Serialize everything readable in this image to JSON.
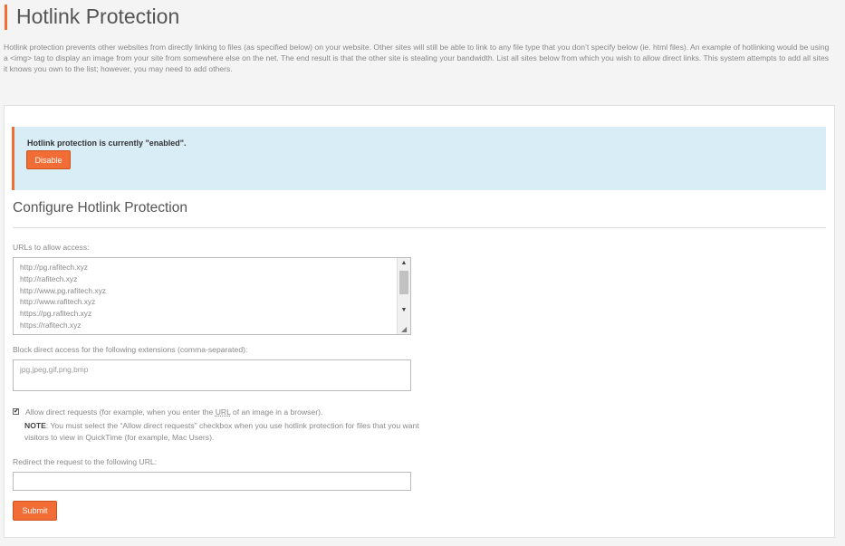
{
  "page": {
    "title": "Hotlink Protection",
    "description": "Hotlink protection prevents other websites from directly linking to files (as specified below) on your website. Other sites will still be able to link to any file type that you don’t specify below (ie. html files). An example of hotlinking would be using a <img> tag to display an image from your site from somewhere else on the net. The end result is that the other site is stealing your bandwidth. List all sites below from which you wish to allow direct links. This system attempts to add all sites it knows you own to the list; however, you may need to add others."
  },
  "status": {
    "message": "Hotlink protection is currently \"enabled\".",
    "disable_label": "Disable"
  },
  "form": {
    "section_title": "Configure Hotlink Protection",
    "urls_label": "URLs to allow access:",
    "urls": [
      "http://pg.rafitech.xyz",
      "http://rafitech.xyz",
      "http://www.pg.rafitech.xyz",
      "http://www.rafitech.xyz",
      "https://pg.rafitech.xyz",
      "https://rafitech.xyz"
    ],
    "extensions_label": "Block direct access for the following extensions (comma-separated):",
    "extensions_value": "jpg,jpeg,gif,png,bmp",
    "allow_direct": {
      "checked": true,
      "label_before": "Allow direct requests (for example, when you enter the ",
      "label_abbr": "URL",
      "label_after": " of an image in a browser).",
      "note_strong": "NOTE",
      "note_text": ": You must select the “Allow direct requests” checkbox when you use hotlink protection for files that you want visitors to view in QuickTime (for example, Mac Users)."
    },
    "redirect_label": "Redirect the request to the following URL:",
    "redirect_value": "",
    "submit_label": "Submit"
  },
  "colors": {
    "accent": "#f26d36",
    "alert_bg": "#d9edf7"
  }
}
